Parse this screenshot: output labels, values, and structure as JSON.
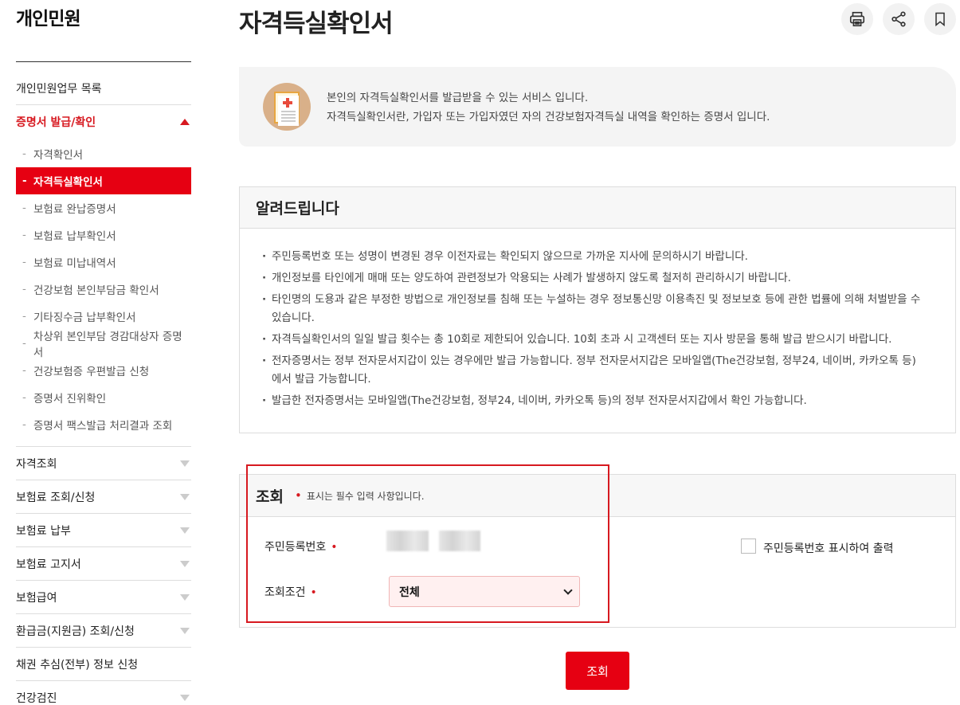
{
  "sidebar": {
    "title": "개인민원",
    "items_top": [
      {
        "label": "개인민원업무 목록"
      }
    ],
    "active_section": {
      "label": "증명서 발급/확인",
      "sub_items": [
        {
          "label": "자격확인서"
        },
        {
          "label": "자격득실확인서"
        },
        {
          "label": "보험료 완납증명서"
        },
        {
          "label": "보험료 납부확인서"
        },
        {
          "label": "보험료 미납내역서"
        },
        {
          "label": "건강보험 본인부담금 확인서"
        },
        {
          "label": "기타징수금 납부확인서"
        },
        {
          "label": "차상위 본인부담 경감대상자 증명서"
        },
        {
          "label": "건강보험증 우편발급 신청"
        },
        {
          "label": "증명서 진위확인"
        },
        {
          "label": "증명서 팩스발급 처리결과 조회"
        }
      ]
    },
    "items_bottom": [
      {
        "label": "자격조회"
      },
      {
        "label": "보험료 조회/신청"
      },
      {
        "label": "보험료 납부"
      },
      {
        "label": "보험료 고지서"
      },
      {
        "label": "보험급여"
      },
      {
        "label": "환급금(지원금) 조회/신청"
      },
      {
        "label": "채권 추심(전부) 정보 신청"
      },
      {
        "label": "건강검진"
      }
    ]
  },
  "header": {
    "title": "자격득실확인서",
    "icons": [
      "printer-icon",
      "share-icon",
      "bookmark-icon"
    ]
  },
  "intro": {
    "line1": "본인의 자격득실확인서를 발급받을 수 있는 서비스 입니다.",
    "line2": "자격득실확인서란, 가입자 또는 가입자였던 자의 건강보험자격득실 내역을 확인하는 증명서 입니다."
  },
  "notice": {
    "title": "알려드립니다",
    "items": [
      "주민등록번호 또는 성명이 변경된 경우 이전자료는 확인되지 않으므로 가까운 지사에 문의하시기 바랍니다.",
      "개인정보를 타인에게 매매 또는 양도하여 관련정보가 악용되는 사례가 발생하지 않도록 철저히 관리하시기 바랍니다.",
      "타인명의 도용과 같은 부정한 방법으로 개인정보를 침해 또는 누설하는 경우 정보통신망 이용촉진 및 정보보호 등에 관한 법률에 의해 처벌받을 수 있습니다.",
      "자격득실확인서의 일일 발급 횟수는 총 10회로 제한되어 있습니다. 10회 초과 시 고객센터 또는 지사 방문을 통해 발급 받으시기 바랍니다.",
      "전자증명서는 정부 전자문서지갑이 있는 경우에만 발급 가능합니다. 정부 전자문서지갑은 모바일앱(The건강보험, 정부24, 네이버, 카카오톡 등)에서 발급 가능합니다.",
      "발급한 전자증명서는 모바일앱(The건강보험, 정부24, 네이버, 카카오톡 등)의 정부 전자문서지갑에서 확인 가능합니다."
    ]
  },
  "query": {
    "title": "조회",
    "required_note": "표시는 필수 입력 사항입니다.",
    "resident_label": "주민등록번호",
    "condition_label": "조회조건",
    "condition_value": "전체",
    "checkbox_label": "주민등록번호 표시하여 출력",
    "submit_label": "조회"
  },
  "colors": {
    "accent": "#e60012",
    "sidebar_active_text": "#d71920"
  }
}
